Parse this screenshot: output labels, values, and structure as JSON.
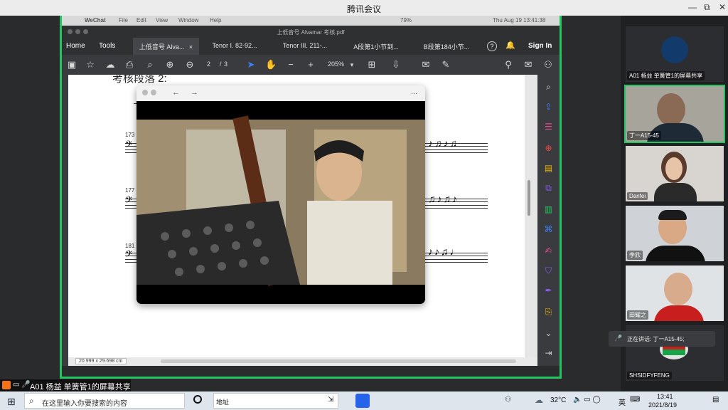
{
  "window": {
    "title": "腾讯会议",
    "minimize": "—",
    "restore": "⧉",
    "close": "✕"
  },
  "mac_menubar": {
    "app": "WeChat",
    "items": [
      "File",
      "Edit",
      "View",
      "Window",
      "Help"
    ],
    "clock": "Thu Aug 19  13:41:38",
    "battery": "79%"
  },
  "pdf": {
    "file_title": "上低音号 Alvamar 考核.pdf",
    "nav": {
      "home": "Home",
      "tools": "Tools",
      "sign_in": "Sign In"
    },
    "tabs": [
      {
        "label": "上低音号 Alva...",
        "active": true,
        "close": "×"
      },
      {
        "label": "Tenor I. 82-92...",
        "active": false
      },
      {
        "label": "Tenor III. 211-...",
        "active": false
      },
      {
        "label": "A段第1小节到...",
        "active": false
      },
      {
        "label": "B段第184小节...",
        "active": false
      }
    ],
    "page_current": "2",
    "page_sep": "/",
    "page_total": "3",
    "zoom": "205%",
    "heading": "考核段落 2:",
    "measures": [
      "173",
      "177",
      "181"
    ],
    "page_size": "20.999 x 29.698 cm"
  },
  "video_window": {
    "back": "←",
    "forward": "→",
    "more": "..."
  },
  "participants": [
    {
      "name": "A01 杨益 单簧管1的屏幕共享",
      "type": "share"
    },
    {
      "name": "丁一A15-45",
      "active": true
    },
    {
      "name": "Danfei"
    },
    {
      "name": "李欣"
    },
    {
      "name": "田耀之"
    },
    {
      "name": "SHSIDFYFENG"
    }
  ],
  "speaking_tip": "正在讲话: 丁一A15-45;",
  "share_label": "A01 杨益 单簧管1的屏幕共享",
  "taskbar": {
    "search_placeholder": "在这里输入你要搜索的内容",
    "address_label": "地址",
    "temperature": "32°C",
    "ime": "英",
    "time": "13:41",
    "date": "2021/8/19"
  },
  "colors": {
    "share_border": "#22c55e",
    "accent_blue": "#3b82f6",
    "sidetool_pink": "#ec4899"
  }
}
